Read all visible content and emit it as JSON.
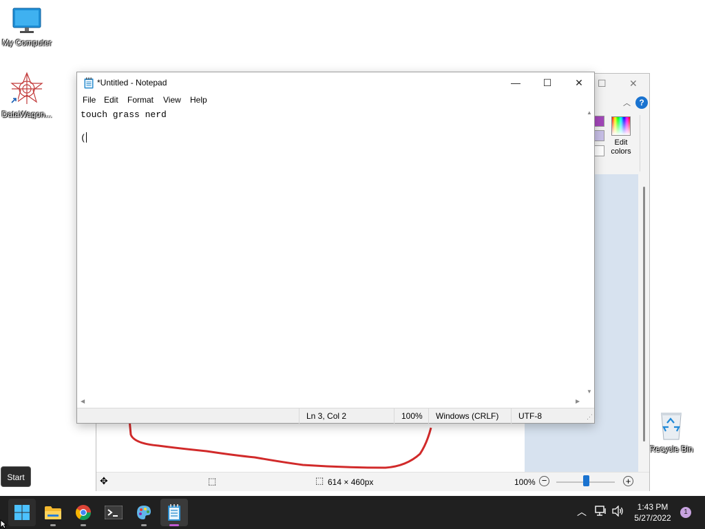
{
  "desktop": {
    "icons": [
      {
        "label": "My Computer",
        "icon": "monitor-icon"
      },
      {
        "label": "DataWagon...",
        "icon": "datawagon-app-icon"
      },
      {
        "label": "Recycle Bin",
        "icon": "recycle-bin-icon"
      }
    ]
  },
  "notepad": {
    "title": "*Untitled - Notepad",
    "menu": [
      "File",
      "Edit",
      "Format",
      "View",
      "Help"
    ],
    "content_line1": "touch grass nerd",
    "content_line3": "(",
    "status": {
      "position": "Ln 3, Col 2",
      "zoom": "100%",
      "line_ending": "Windows (CRLF)",
      "encoding": "UTF-8"
    },
    "buttons": {
      "minimize": "—",
      "maximize": "☐",
      "close": "✕"
    }
  },
  "paint": {
    "edit_colors_line1": "Edit",
    "edit_colors_line2": "colors",
    "status": {
      "dimensions": "614 × 460px",
      "zoom": "100%"
    },
    "colors": {
      "purple": "#a347ba",
      "lavender": "#c8bfe7",
      "stroke": "#d12a2a"
    }
  },
  "start_tooltip": "Start",
  "taskbar": {
    "apps": [
      "start-icon",
      "file-explorer-icon",
      "chrome-icon",
      "terminal-icon",
      "paint-icon",
      "notepad-icon"
    ],
    "time": "1:43 PM",
    "date": "5/27/2022",
    "notification_count": "1",
    "accent": "#c05ad2"
  }
}
